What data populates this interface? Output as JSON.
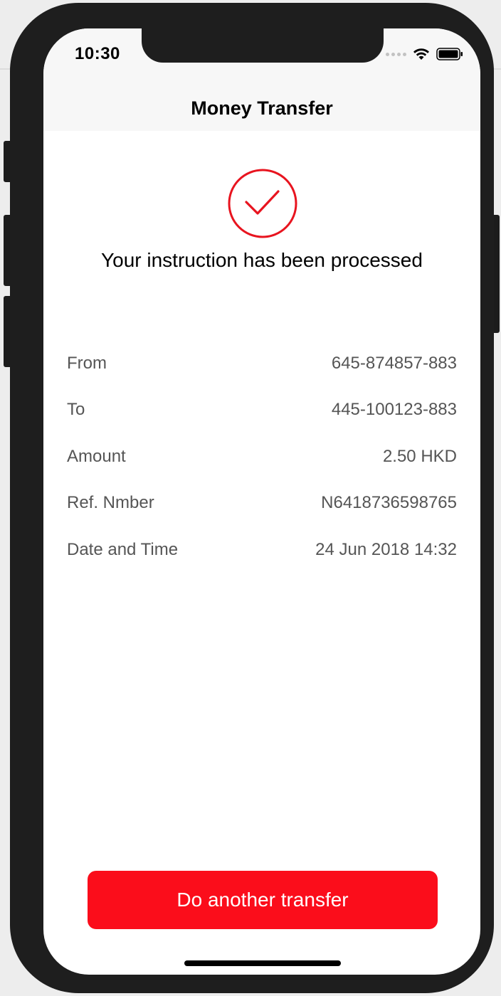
{
  "status_bar": {
    "time": "10:30"
  },
  "nav": {
    "title": "Money Transfer"
  },
  "confirmation": {
    "icon": "check-circle-icon",
    "message": "Your instruction has been processed"
  },
  "details": [
    {
      "label": "From",
      "value": "645-874857-883"
    },
    {
      "label": "To",
      "value": "445-100123-883"
    },
    {
      "label": "Amount",
      "value": "2.50 HKD"
    },
    {
      "label": "Ref. Nmber",
      "value": "N6418736598765"
    },
    {
      "label": "Date and Time",
      "value": "24 Jun 2018 14:32"
    }
  ],
  "actions": {
    "primary_label": "Do another transfer"
  },
  "colors": {
    "accent": "#fb0d1b",
    "check_stroke": "#e8141f",
    "text_secondary": "#555555"
  }
}
